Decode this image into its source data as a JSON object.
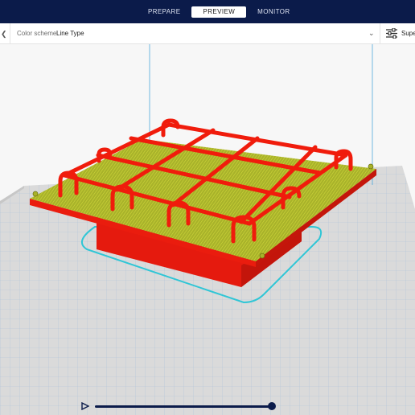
{
  "header": {
    "tabs": [
      {
        "label": "PREPARE",
        "active": false
      },
      {
        "label": "PREVIEW",
        "active": true
      },
      {
        "label": "MONITOR",
        "active": false
      }
    ]
  },
  "toolbar": {
    "color_scheme_label": "Color scheme",
    "color_scheme_value": "Line Type",
    "settings_label": "Supe"
  },
  "colors": {
    "header_bg": "#0b1b4a",
    "model_red": "#f01c0c",
    "infill_yellow": "#b7bf2a",
    "skirt_cyan": "#33c9d6",
    "build_plate": "#d9d9d9"
  },
  "icons": [
    "chevron-left-icon",
    "chevron-down-icon",
    "settings-sliders-icon",
    "play-icon"
  ]
}
